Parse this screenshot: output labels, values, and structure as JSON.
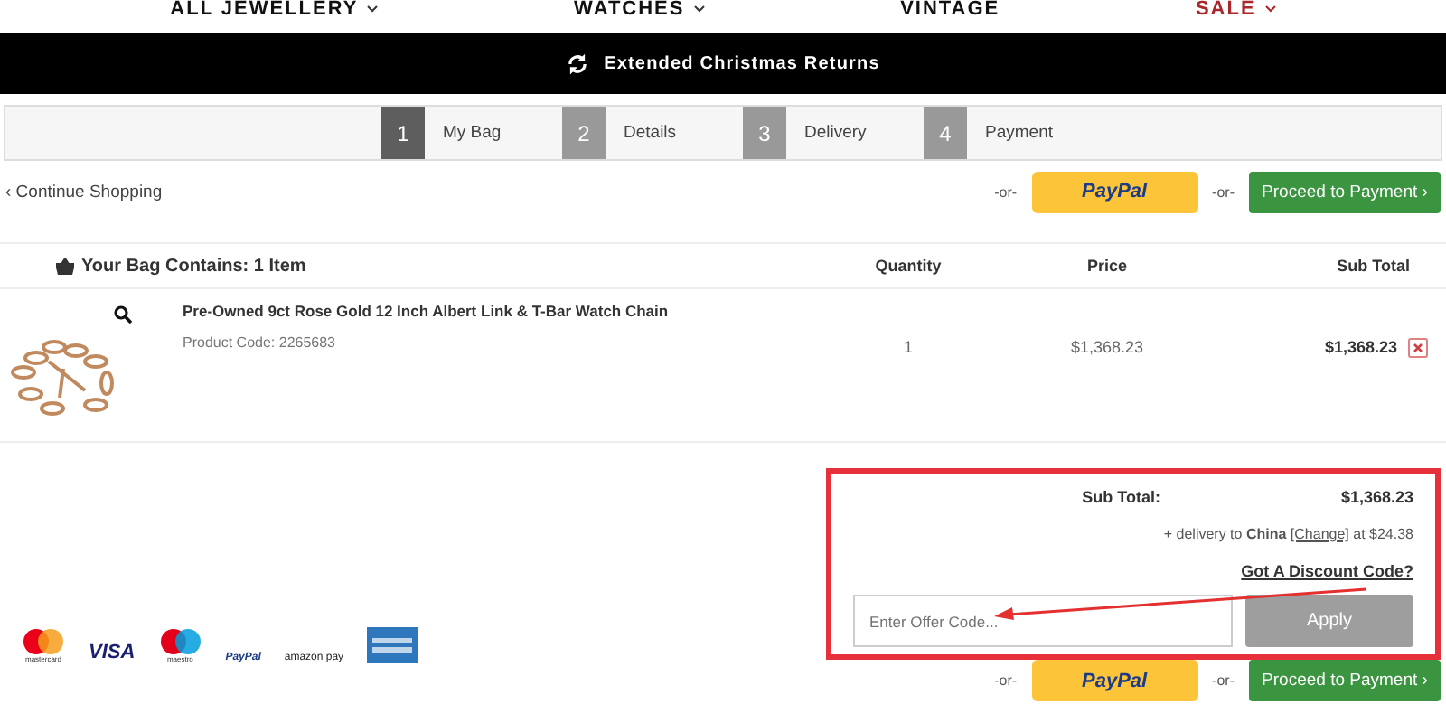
{
  "nav": [
    {
      "label": "ALL JEWELLERY",
      "caret": true,
      "kind": "normal"
    },
    {
      "label": "WATCHES",
      "caret": true,
      "kind": "normal"
    },
    {
      "label": "VINTAGE",
      "caret": false,
      "kind": "normal"
    },
    {
      "label": "SALE",
      "caret": true,
      "kind": "sale"
    }
  ],
  "banner": {
    "text": "Extended Christmas Returns"
  },
  "steps": [
    {
      "number": "1",
      "label": "My Bag",
      "selected": true
    },
    {
      "number": "2",
      "label": "Details",
      "selected": false
    },
    {
      "number": "3",
      "label": "Delivery",
      "selected": false
    },
    {
      "number": "4",
      "label": "Payment",
      "selected": false
    }
  ],
  "continue_link": "‹ Continue Shopping",
  "or_texts": [
    "-or-",
    "-or-"
  ],
  "paypal_button": "PayPal",
  "proceed_button": "Proceed to Payment ›",
  "bag": {
    "heading": "Your Bag Contains: 1 Item",
    "columns": [
      "Quantity",
      "Price",
      "Sub Total"
    ]
  },
  "items": [
    {
      "name": "Pre-Owned 9ct Rose Gold 12 Inch Albert Link & T-Bar Watch Chain",
      "code": "Product Code: 2265683",
      "quantity": "1",
      "price": "$1,368.23",
      "subtotal": "$1,368.23"
    }
  ],
  "summary": {
    "label": "Sub Total:",
    "value": "$1,368.23",
    "delivery_prefix": "+ delivery to",
    "country": "China",
    "change_link": "[Change]",
    "delivery_suffix": "at $24.38",
    "discount_link": "Got A Discount Code?",
    "offer_placeholder": "Enter Offer Code...",
    "apply_button": "Apply"
  },
  "bottom": {
    "or_texts": [
      "-or-",
      "-or-"
    ],
    "paypal_button": "PayPal",
    "proceed_button": "Proceed to Payment ›"
  },
  "payment_logos": [
    {
      "kind": "mastercard",
      "caption": "mastercard"
    },
    {
      "kind": "visa",
      "caption": "VISA"
    },
    {
      "kind": "maestro",
      "caption": "maestro"
    },
    {
      "kind": "paypal",
      "caption": "PayPal"
    },
    {
      "kind": "amazon",
      "caption": "amazon pay"
    },
    {
      "kind": "amex"
    }
  ]
}
